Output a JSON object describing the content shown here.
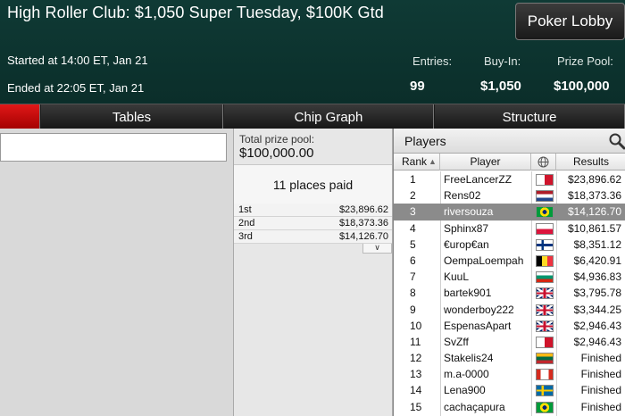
{
  "header": {
    "title": "High Roller Club: $1,050 Super Tuesday, $100K Gtd",
    "started": "Started at 14:00 ET, Jan 21",
    "ended": "Ended at 22:05 ET, Jan 21",
    "lobby_button": "Poker Lobby",
    "stats": {
      "entries_label": "Entries:",
      "entries_value": "99",
      "buyin_label": "Buy-In:",
      "buyin_value": "$1,050",
      "prizepool_label": "Prize Pool:",
      "prizepool_value": "$100,000"
    }
  },
  "tabs": [
    "",
    "Tables",
    "Chip Graph",
    "Structure"
  ],
  "prize": {
    "total_label": "Total prize pool:",
    "total_value": "$100,000.00",
    "places_paid": "11 places paid",
    "payouts": [
      {
        "place": "1st",
        "amount": "$23,896.62"
      },
      {
        "place": "2nd",
        "amount": "$18,373.36"
      },
      {
        "place": "3rd",
        "amount": "$14,126.70"
      }
    ]
  },
  "players_panel": {
    "title": "Players",
    "columns": {
      "rank": "Rank",
      "player": "Player",
      "results": "Results"
    },
    "rows": [
      {
        "rank": "1",
        "player": "FreeLancerZZ",
        "flag": "malta",
        "result": "$23,896.62"
      },
      {
        "rank": "2",
        "player": "Rens02",
        "flag": "netherlands",
        "result": "$18,373.36"
      },
      {
        "rank": "3",
        "player": "riversouza",
        "flag": "brazil",
        "result": "$14,126.70"
      },
      {
        "rank": "4",
        "player": "Sphinx87",
        "flag": "poland",
        "result": "$10,861.57"
      },
      {
        "rank": "5",
        "player": "€urop€an",
        "flag": "finland",
        "result": "$8,351.12"
      },
      {
        "rank": "6",
        "player": "OempaLoempah",
        "flag": "belgium",
        "result": "$6,420.91"
      },
      {
        "rank": "7",
        "player": "KuuL",
        "flag": "bulgaria",
        "result": "$4,936.83"
      },
      {
        "rank": "8",
        "player": "bartek901",
        "flag": "uk",
        "result": "$3,795.78"
      },
      {
        "rank": "9",
        "player": "wonderboy222",
        "flag": "uk",
        "result": "$3,344.25"
      },
      {
        "rank": "10",
        "player": "EspenasApart",
        "flag": "uk",
        "result": "$2,946.43"
      },
      {
        "rank": "11",
        "player": "SvZff",
        "flag": "malta",
        "result": "$2,946.43"
      },
      {
        "rank": "12",
        "player": "Stakelis24",
        "flag": "lithuania",
        "result": "Finished"
      },
      {
        "rank": "13",
        "player": "m.a-0000",
        "flag": "canada",
        "result": "Finished"
      },
      {
        "rank": "14",
        "player": "Lena900",
        "flag": "sweden",
        "result": "Finished"
      },
      {
        "rank": "15",
        "player": "cachaçapura",
        "flag": "brazil",
        "result": "Finished"
      }
    ],
    "selected_rank": "3"
  }
}
